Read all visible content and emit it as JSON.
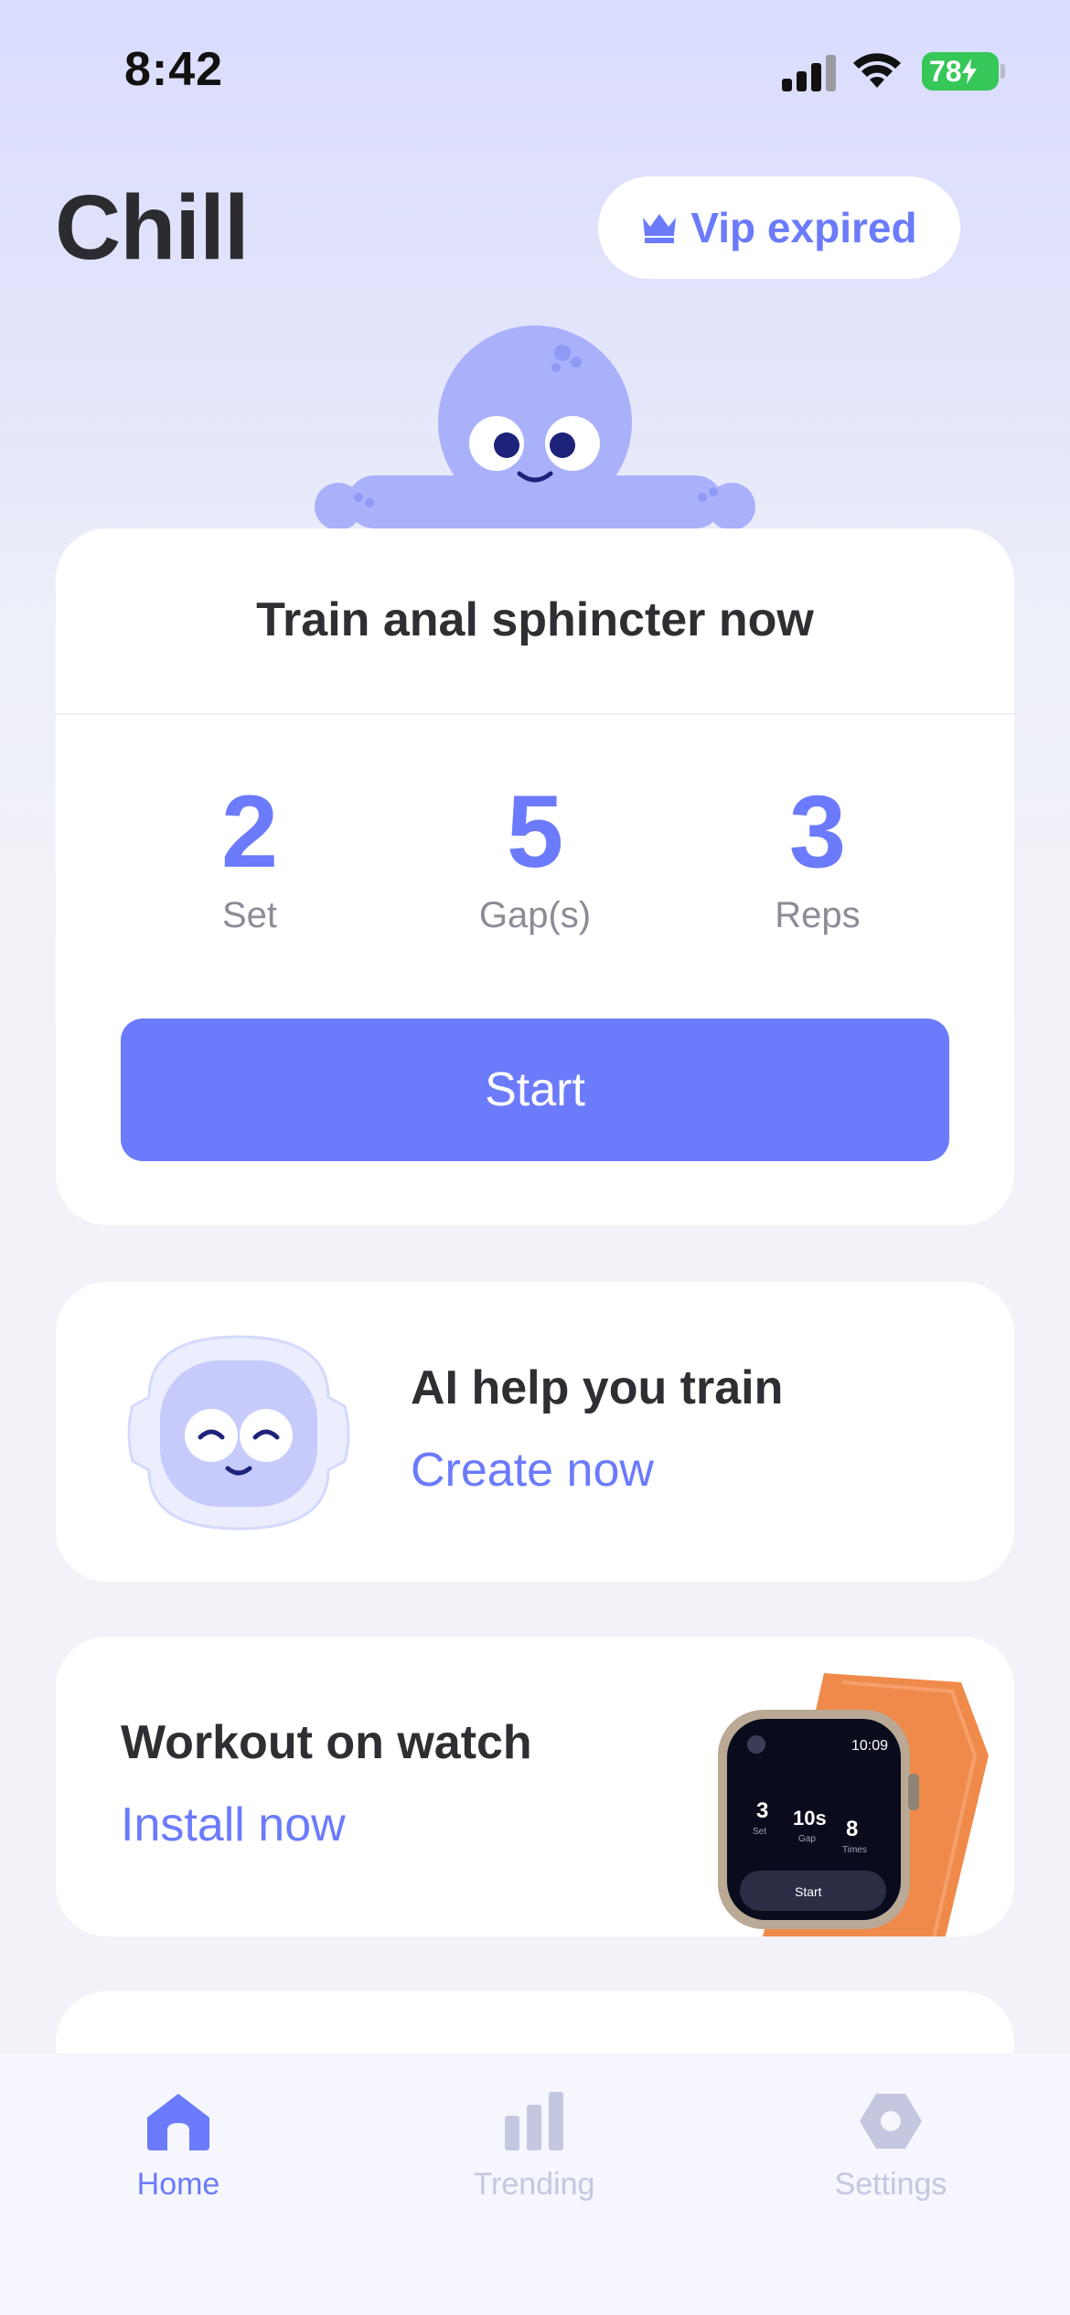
{
  "status_bar": {
    "time": "8:42",
    "battery": "78"
  },
  "header": {
    "title": "Chill",
    "vip_label": "Vip expired"
  },
  "train_card": {
    "title": "Train anal sphincter now",
    "stats": [
      {
        "value": "2",
        "label": "Set"
      },
      {
        "value": "5",
        "label": "Gap(s)"
      },
      {
        "value": "3",
        "label": "Reps"
      }
    ],
    "start_label": "Start"
  },
  "ai_card": {
    "title": "AI help you train",
    "link": "Create now"
  },
  "watch_card": {
    "title": "Workout on watch",
    "link": "Install now",
    "watch_screen": {
      "time": "10:09",
      "set": "3",
      "gap": "10s",
      "times": "8",
      "set_label": "Set",
      "gap_label": "Gap",
      "times_label": "Times",
      "start": "Start"
    }
  },
  "tab_bar": {
    "items": [
      {
        "label": "Home",
        "icon": "home-icon",
        "active": true
      },
      {
        "label": "Trending",
        "icon": "bar-chart-icon",
        "active": false
      },
      {
        "label": "Settings",
        "icon": "hexagon-settings-icon",
        "active": false
      }
    ]
  },
  "colors": {
    "accent": "#6b7bfb",
    "background": "#f2f3f8",
    "header_gradient": "#d9dcfd",
    "battery": "#36c759",
    "watch_band": "#f08a4b"
  }
}
